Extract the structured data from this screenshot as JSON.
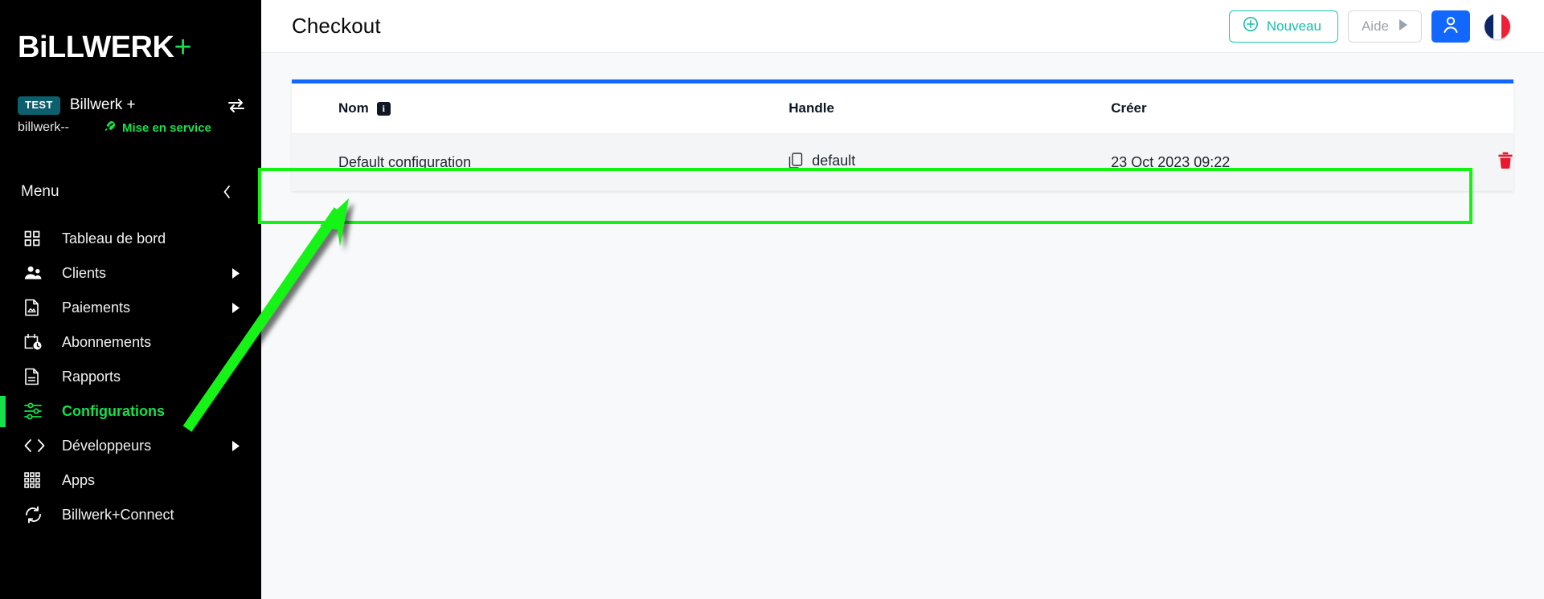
{
  "sidebar": {
    "logo": {
      "text": "BiLLWERK",
      "plus": "+"
    },
    "tenant": {
      "badge": "TEST",
      "name": "Billwerk +",
      "handle": "billwerk--",
      "status": "Mise en service",
      "switch_icon": "switch-arrows-icon",
      "rocket_icon": "rocket-icon"
    },
    "menu_label": "Menu",
    "collapse_icon": "chevron-left-icon",
    "items": [
      {
        "label": "Tableau de bord",
        "icon": "dashboard-grid-icon",
        "has_caret": false,
        "active": false
      },
      {
        "label": "Clients",
        "icon": "users-icon",
        "has_caret": true,
        "active": false
      },
      {
        "label": "Paiements",
        "icon": "invoice-icon",
        "has_caret": true,
        "active": false
      },
      {
        "label": "Abonnements",
        "icon": "calendar-clock-icon",
        "has_caret": false,
        "active": false
      },
      {
        "label": "Rapports",
        "icon": "document-lines-icon",
        "has_caret": false,
        "active": false
      },
      {
        "label": "Configurations",
        "icon": "sliders-icon",
        "has_caret": false,
        "active": true
      },
      {
        "label": "Développeurs",
        "icon": "code-brackets-icon",
        "has_caret": true,
        "active": false
      },
      {
        "label": "Apps",
        "icon": "apps-grid-icon",
        "has_caret": false,
        "active": false
      },
      {
        "label": "Billwerk+Connect",
        "icon": "sync-refresh-icon",
        "has_caret": false,
        "active": false
      }
    ]
  },
  "header": {
    "title": "Checkout",
    "new_button": {
      "label": "Nouveau",
      "icon": "plus-circle-icon"
    },
    "help_button": {
      "label": "Aide",
      "icon": "play-triangle-icon"
    },
    "account_button": {
      "icon": "user-person-icon"
    },
    "language_flag": {
      "icon": "flag-france-icon"
    }
  },
  "table": {
    "columns": [
      {
        "key": "nom",
        "label": "Nom",
        "info_icon": "info-square-icon"
      },
      {
        "key": "handle",
        "label": "Handle"
      },
      {
        "key": "creer",
        "label": "Créer"
      },
      {
        "key": "actions",
        "label": ""
      }
    ],
    "rows": [
      {
        "nom": "Default configuration",
        "handle": "default",
        "handle_icon": "copy-icon",
        "creer": "23 Oct 2023 09:22",
        "delete_icon": "trash-icon"
      }
    ]
  },
  "annotations": {
    "highlight_color": "#12f312",
    "arrow_color": "#12f312",
    "accent_blue": "#1267ff",
    "accent_green": "#16e04b",
    "accent_teal": "#17bfa8",
    "danger_red": "#e8192c"
  }
}
